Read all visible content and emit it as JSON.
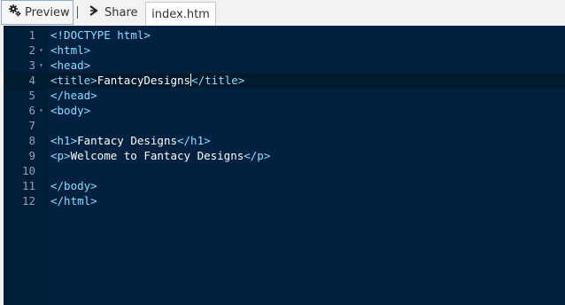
{
  "toolbar": {
    "preview_label": "Preview",
    "share_label": "Share"
  },
  "tabs": [
    {
      "label": "index.htm",
      "active": true
    }
  ],
  "editor": {
    "theme": {
      "background": "#00213f",
      "tag_color": "#8fdcff",
      "text_color": "#ffffff"
    },
    "active_line": 4,
    "lines": [
      {
        "num": "1",
        "fold": "",
        "parts": [
          {
            "t": "tag",
            "v": "<!DOCTYPE html>"
          }
        ]
      },
      {
        "num": "2",
        "fold": "▾",
        "parts": [
          {
            "t": "tag",
            "v": "<html>"
          }
        ]
      },
      {
        "num": "3",
        "fold": "▾",
        "parts": [
          {
            "t": "tag",
            "v": "<head>"
          }
        ]
      },
      {
        "num": "4",
        "fold": "",
        "parts": [
          {
            "t": "tag",
            "v": "<title>"
          },
          {
            "t": "txt",
            "v": "FantacyDesigns"
          },
          {
            "t": "caret",
            "v": ""
          },
          {
            "t": "tag",
            "v": "</title>"
          }
        ]
      },
      {
        "num": "5",
        "fold": "",
        "parts": [
          {
            "t": "tag",
            "v": "</head>"
          }
        ]
      },
      {
        "num": "6",
        "fold": "▾",
        "parts": [
          {
            "t": "tag",
            "v": "<body>"
          }
        ]
      },
      {
        "num": "7",
        "fold": "",
        "parts": []
      },
      {
        "num": "8",
        "fold": "",
        "parts": [
          {
            "t": "tag",
            "v": "<h1>"
          },
          {
            "t": "txt",
            "v": "Fantacy Designs"
          },
          {
            "t": "tag",
            "v": "</h1>"
          }
        ]
      },
      {
        "num": "9",
        "fold": "",
        "parts": [
          {
            "t": "tag",
            "v": "<p>"
          },
          {
            "t": "txt",
            "v": "Welcome to Fantacy Designs"
          },
          {
            "t": "tag",
            "v": "</p>"
          }
        ]
      },
      {
        "num": "10",
        "fold": "",
        "parts": []
      },
      {
        "num": "11",
        "fold": "",
        "parts": [
          {
            "t": "tag",
            "v": "</body>"
          }
        ]
      },
      {
        "num": "12",
        "fold": "",
        "parts": [
          {
            "t": "tag",
            "v": "</html>"
          }
        ]
      }
    ]
  }
}
